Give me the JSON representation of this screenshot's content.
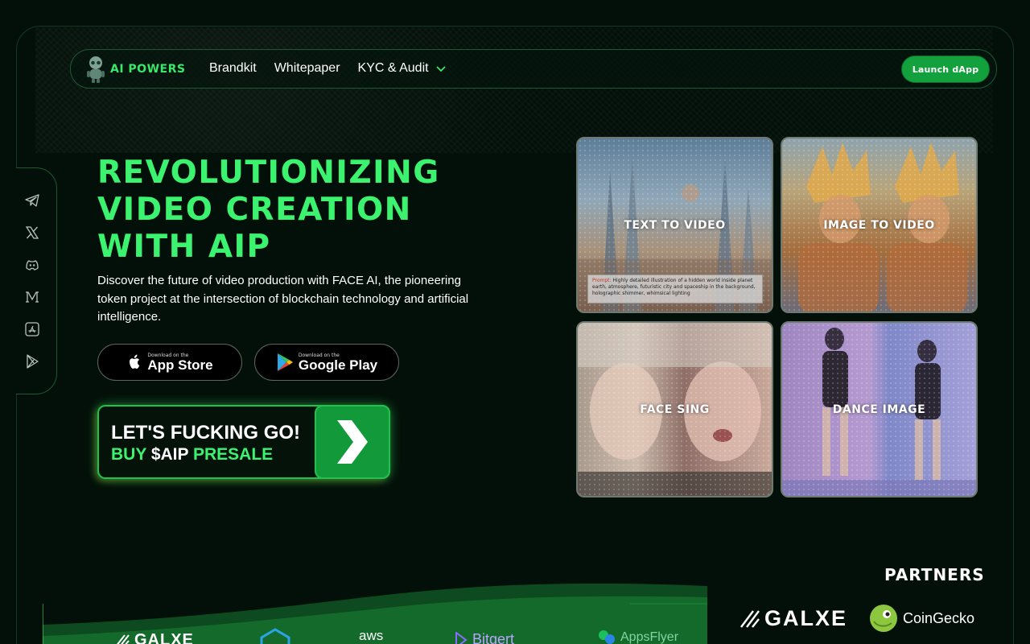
{
  "header": {
    "brand": "AI POWERS",
    "nav": [
      {
        "label": "Brandkit"
      },
      {
        "label": "Whitepaper"
      },
      {
        "label": "KYC & Audit"
      }
    ],
    "launch_label": "Launch dApp"
  },
  "social_icons": [
    "telegram-icon",
    "x-icon",
    "discord-icon",
    "medium-icon",
    "app-store-icon",
    "google-play-icon"
  ],
  "hero": {
    "title_lines": [
      "Revolutionizing",
      "Video Creation",
      "with AIP"
    ],
    "description": "Discover the future of video production with FACE AI, the pioneering token project at the intersection of blockchain technology and artificial intelligence.",
    "app_store": {
      "small": "Download on the",
      "big": "App Store"
    },
    "google_play": {
      "small": "Download on the",
      "big": "Google Play"
    },
    "cta": {
      "line1": "LET'S FUCKING GO!",
      "buy": "BUY",
      "token": "$AIP",
      "presale": "PRESALE"
    }
  },
  "cards": [
    {
      "label": "TEXT TO VIDEO",
      "prompt_key": "Prompt:",
      "prompt_text": "Highly detailed illustration of a hidden world inside planet earth, atmosphere, futuristic city and spaceship in the background, holographic shimmer, whimsical lighting"
    },
    {
      "label": "IMAGE TO VIDEO"
    },
    {
      "label": "FACE SING"
    },
    {
      "label": "DANCE IMAGE"
    }
  ],
  "partners": {
    "title": "PARTNERS",
    "featured": [
      {
        "name": "GALXE"
      },
      {
        "name": "CoinGecko"
      }
    ],
    "strip": [
      {
        "name": "GALXE"
      },
      {
        "name": "aws"
      },
      {
        "name": "Bitgert"
      },
      {
        "name": "AppsFlyer"
      }
    ]
  },
  "colors": {
    "accent": "#3cf36f",
    "button": "#13a13e",
    "background": "#030f09"
  }
}
